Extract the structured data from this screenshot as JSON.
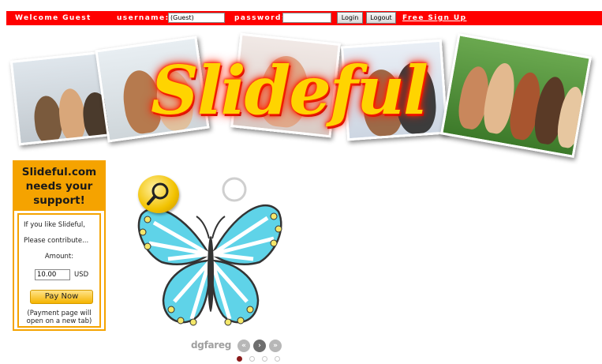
{
  "topbar": {
    "welcome": "Welcome Guest",
    "username_label": "username:",
    "username_value": "(Guest)",
    "password_label": "password:",
    "password_value": "",
    "login_label": "Login",
    "logout_label": "Logout",
    "signup_label": "Free Sign Up"
  },
  "banner": {
    "logo_text": "Slideful"
  },
  "support": {
    "title": "Slideful.com needs your support!",
    "line1": "If you like Slideful,",
    "line2": "Please contribute...",
    "amount_label": "Amount:",
    "amount_value": "10.00",
    "currency": "USD",
    "pay_button": "Pay Now",
    "note": "(Payment page will open on a new tab)"
  },
  "slideshow": {
    "caption": "dgfareg",
    "nav_first": "«",
    "nav_next": "›",
    "nav_last": "»",
    "current_slide": 1,
    "total_slides": 4
  },
  "colors": {
    "topbar": "#ff0000",
    "support_accent": "#f5a300",
    "logo": "#ffd400"
  }
}
